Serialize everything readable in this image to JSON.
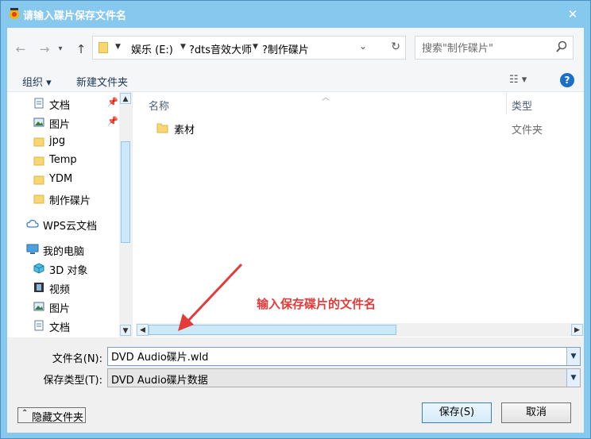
{
  "window": {
    "title": "请输入碟片保存文件名",
    "close_glyph": "✕"
  },
  "nav": {
    "back_glyph": "←",
    "forward_glyph": "→",
    "recent_glyph": "▾",
    "up_glyph": "↑",
    "breadcrumb": [
      "娱乐 (E:)",
      "?dts音效大师",
      "?制作碟片"
    ],
    "addr_dropdown_glyph": "⌄",
    "refresh_glyph": "↻"
  },
  "search": {
    "placeholder": "搜索\"制作碟片\""
  },
  "toolbar": {
    "organize": "组织 ▾",
    "new_folder": "新建文件夹",
    "view": "☷ ▾",
    "help": "?"
  },
  "sidebar": {
    "items": [
      {
        "label": "文档",
        "icon": "document-icon",
        "pinned": true
      },
      {
        "label": "图片",
        "icon": "picture-icon",
        "pinned": true
      },
      {
        "label": "jpg",
        "icon": "folder-icon"
      },
      {
        "label": "Temp",
        "icon": "folder-icon"
      },
      {
        "label": "YDM",
        "icon": "folder-icon"
      },
      {
        "label": "制作碟片",
        "icon": "folder-icon"
      },
      {
        "label": "WPS云文档",
        "icon": "cloud-icon"
      },
      {
        "label": "我的电脑",
        "icon": "computer-icon"
      },
      {
        "label": "3D 对象",
        "icon": "cube-icon"
      },
      {
        "label": "视频",
        "icon": "video-icon"
      },
      {
        "label": "图片",
        "icon": "picture-icon"
      },
      {
        "label": "文档",
        "icon": "document-icon"
      }
    ],
    "pin_glyph": "📌"
  },
  "file_list": {
    "columns": {
      "name": "名称",
      "type": "类型"
    },
    "rows": [
      {
        "name": "素材",
        "type": "文件夹"
      }
    ]
  },
  "annotation": {
    "text": "输入保存碟片的文件名"
  },
  "form": {
    "filename_label": "文件名(N):",
    "filename_value": "DVD Audio碟片.wld",
    "filetype_label": "保存类型(T):",
    "filetype_value": "DVD Audio碟片数据"
  },
  "buttons": {
    "hide_folders": "隐藏文件夹",
    "save": "保存(S)",
    "cancel": "取消"
  },
  "colors": {
    "frame": "#86c8ee",
    "accent": "#1a6fc9",
    "annotation": "#e33a3a"
  }
}
